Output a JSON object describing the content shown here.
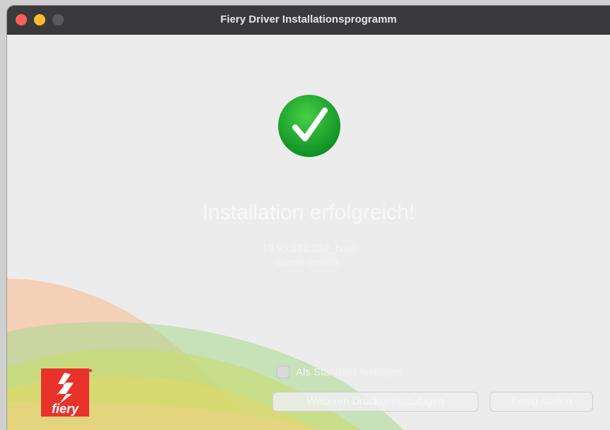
{
  "window": {
    "title": "Fiery Driver Installationsprogramm"
  },
  "content": {
    "headline": "Installation erfolgreich!",
    "printer_name": "10.95.132.232_hold",
    "created_text": "wurde erstellt.",
    "default_checkbox": {
      "label": "Als Standard festlegen",
      "checked": false
    },
    "buttons": {
      "add_printer": "Weiteren Drucker hinzufügen",
      "finish": "Fertig stellen"
    }
  },
  "brand": {
    "logo_text": "fiery",
    "logo_color": "#e8322b",
    "success_color": "#1fa52c"
  },
  "icons": {
    "success": "checkmark-circle-icon",
    "logo": "fiery-lightning-logo"
  }
}
